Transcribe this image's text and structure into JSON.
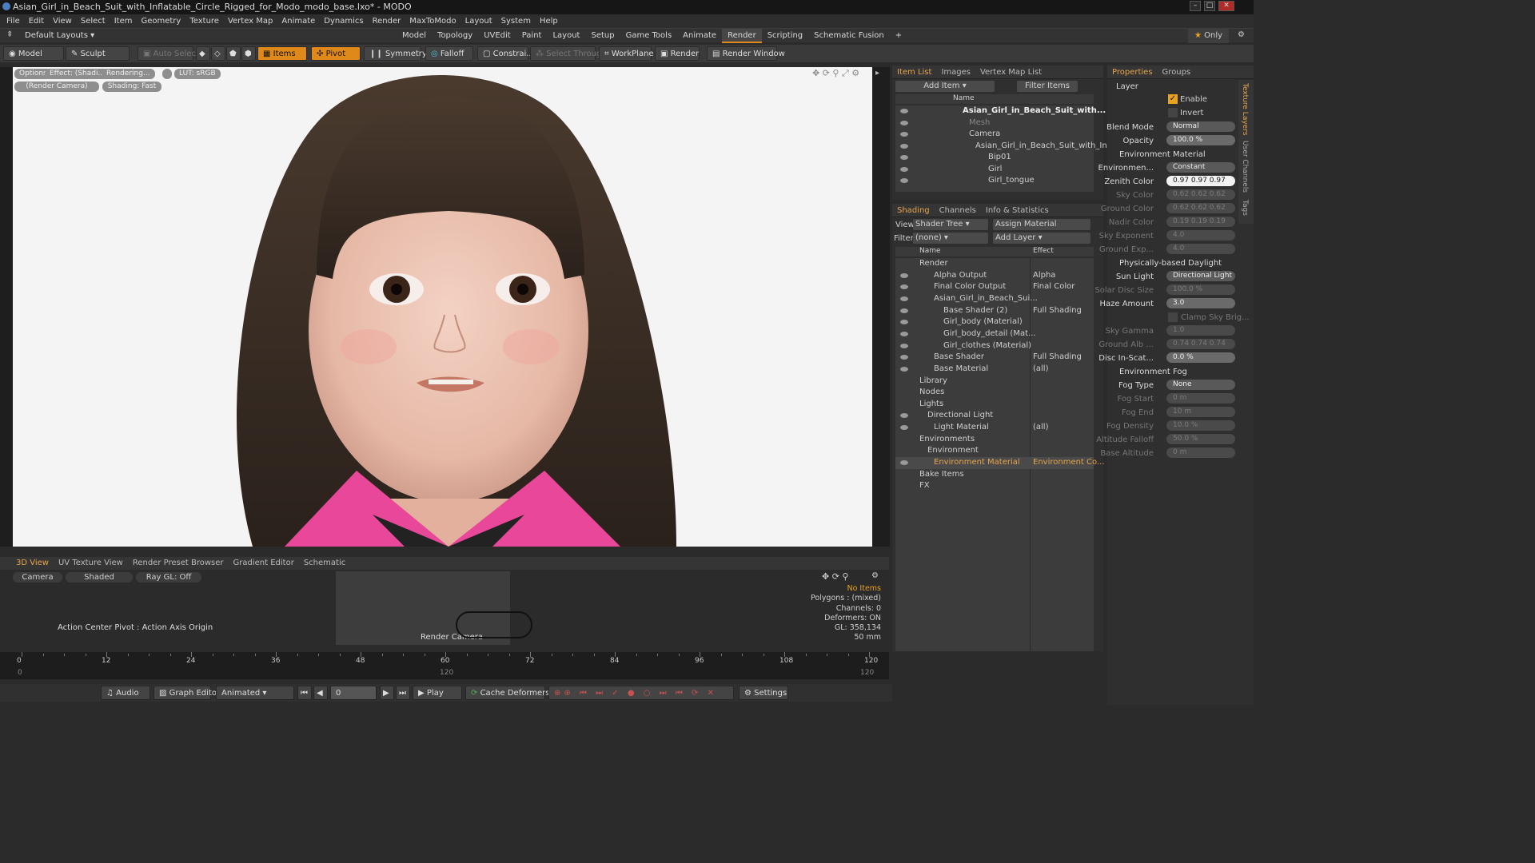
{
  "window": {
    "title": "Asian_Girl_in_Beach_Suit_with_Inflatable_Circle_Rigged_for_Modo_modo_base.lxo* - MODO"
  },
  "menu": [
    "File",
    "Edit",
    "View",
    "Select",
    "Item",
    "Geometry",
    "Texture",
    "Vertex Map",
    "Animate",
    "Dynamics",
    "Render",
    "MaxToModo",
    "Layout",
    "System",
    "Help"
  ],
  "layout_bar": {
    "default_layouts": "Default Layouts",
    "tabs": [
      "Model",
      "Topology",
      "UVEdit",
      "Paint",
      "Layout",
      "Setup",
      "Game Tools",
      "Animate",
      "Render",
      "Scripting",
      "Schematic Fusion"
    ],
    "active_tab": "Render",
    "only_label": "Only"
  },
  "toolbar": {
    "model": "Model",
    "sculpt": "Sculpt",
    "auto_select": "Auto Select",
    "items": "Items",
    "pivot": "Pivot",
    "symmetry": "Symmetry",
    "falloff": "Falloff",
    "constrain": "Constrai...",
    "select_through": "Select Through",
    "workplane": "WorkPlane",
    "render": "Render",
    "render_window": "Render Window"
  },
  "viewport": {
    "pills_row1": [
      "Options",
      "Effect: (Shadi...",
      "Rendering...",
      "LUT: sRGB"
    ],
    "pills_row2": [
      "(Render Camera)",
      "Shading: Fast"
    ]
  },
  "item_list": {
    "tabs": [
      "Item List",
      "Images",
      "Vertex Map List"
    ],
    "add_item": "Add Item",
    "filter_items": "Filter Items",
    "col_name": "Name",
    "rows": [
      "Asian_Girl_in_Beach_Suit_with...",
      "Mesh",
      "Camera",
      "Asian_Girl_in_Beach_Suit_with_In...",
      "Bip01",
      "Girl",
      "Girl_tongue"
    ]
  },
  "shading": {
    "tabs": [
      "Shading",
      "Channels",
      "Info & Statistics"
    ],
    "view_label": "View",
    "view_value": "Shader Tree",
    "assign_material": "Assign Material",
    "filter_label": "Filter",
    "filter_value": "(none)",
    "add_layer": "Add Layer",
    "col_name": "Name",
    "col_effect": "Effect",
    "rows": [
      {
        "name": "Render",
        "effect": ""
      },
      {
        "name": "Alpha Output",
        "effect": "Alpha"
      },
      {
        "name": "Final Color Output",
        "effect": "Final Color"
      },
      {
        "name": "Asian_Girl_in_Beach_Sui...",
        "effect": ""
      },
      {
        "name": "Base Shader (2)",
        "effect": "Full Shading"
      },
      {
        "name": "Girl_body (Material)",
        "effect": ""
      },
      {
        "name": "Girl_body_detail (Mat...",
        "effect": ""
      },
      {
        "name": "Girl_clothes (Material)",
        "effect": ""
      },
      {
        "name": "Base Shader",
        "effect": "Full Shading"
      },
      {
        "name": "Base Material",
        "effect": "(all)"
      },
      {
        "name": "Library",
        "effect": ""
      },
      {
        "name": "Nodes",
        "effect": ""
      },
      {
        "name": "Lights",
        "effect": ""
      },
      {
        "name": "Directional Light",
        "effect": ""
      },
      {
        "name": "Light Material",
        "effect": "(all)"
      },
      {
        "name": "Environments",
        "effect": ""
      },
      {
        "name": "Environment",
        "effect": ""
      },
      {
        "name": "Environment Material",
        "effect": "Environment Co..."
      },
      {
        "name": "Bake Items",
        "effect": ""
      },
      {
        "name": "FX",
        "effect": ""
      }
    ]
  },
  "properties": {
    "tabs": [
      "Properties",
      "Groups"
    ],
    "side_tabs": [
      "Texture Layers",
      "User Channels",
      "Tags"
    ],
    "layer": "Layer",
    "enable": "Enable",
    "invert": "Invert",
    "blend_mode_label": "Blend Mode",
    "blend_mode": "Normal",
    "opacity_label": "Opacity",
    "opacity": "100.0 %",
    "env_material": "Environment Material",
    "environment_label": "Environmen...",
    "environment": "Constant",
    "zenith_label": "Zenith Color",
    "zenith": "0.97 0.97 0.97",
    "sky_label": "Sky Color",
    "sky": "0.62 0.62 0.62",
    "ground_label": "Ground Color",
    "ground": "0.62 0.62 0.62",
    "nadir_label": "Nadir Color",
    "nadir": "0.19 0.19 0.19",
    "sky_exp_label": "Sky Exponent",
    "sky_exp": "4.0",
    "ground_exp_label": "Ground Exp...",
    "ground_exp": "4.0",
    "daylight": "Physically-based Daylight",
    "sun_light_label": "Sun Light",
    "sun_light": "Directional Light",
    "solar_disc_label": "Solar Disc Size",
    "solar_disc": "100.0 %",
    "haze_label": "Haze Amount",
    "haze": "3.0",
    "clamp_sky": "Clamp Sky Brig...",
    "sky_gamma_label": "Sky Gamma",
    "sky_gamma": "1.0",
    "ground_alb_label": "Ground Alb ...",
    "ground_alb": "0.74 0.74 0.74",
    "disc_label": "Disc In-Scat...",
    "disc": "0.0 %",
    "env_fog": "Environment Fog",
    "fog_type_label": "Fog Type",
    "fog_type": "None",
    "fog_start_label": "Fog Start",
    "fog_start": "0 m",
    "fog_end_label": "Fog End",
    "fog_end": "10 m",
    "fog_density_label": "Fog Density",
    "fog_density": "10.0 %",
    "alt_falloff_label": "Altitude Falloff",
    "alt_falloff": "50.0 %",
    "base_alt_label": "Base Altitude",
    "base_alt": "0 m"
  },
  "bottom_panel": {
    "tabs": [
      "3D View",
      "UV Texture View",
      "Render Preset Browser",
      "Gradient Editor",
      "Schematic"
    ],
    "buttons": [
      "Camera",
      "Shaded",
      "Ray GL: Off"
    ],
    "action_center": "Action Center Pivot : Action Axis Origin",
    "render_camera": "Render Camera",
    "stats": {
      "no_items": "No Items",
      "polygons": "Polygons : (mixed)",
      "channels": "Channels: 0",
      "deformers": "Deformers: ON",
      "gl": "GL: 358,134",
      "mm": "50 mm"
    }
  },
  "timeline": {
    "ticks": [
      "0",
      "12",
      "24",
      "36",
      "48",
      "60",
      "72",
      "84",
      "96",
      "108",
      "120"
    ],
    "sub_ticks": [
      "0",
      "120",
      "120"
    ]
  },
  "bottom_bar": {
    "audio": "Audio",
    "graph_editor": "Graph Editor",
    "animated": "Animated",
    "frame": "0",
    "play": "Play",
    "cache_deformers": "Cache Deformers",
    "settings": "Settings"
  }
}
